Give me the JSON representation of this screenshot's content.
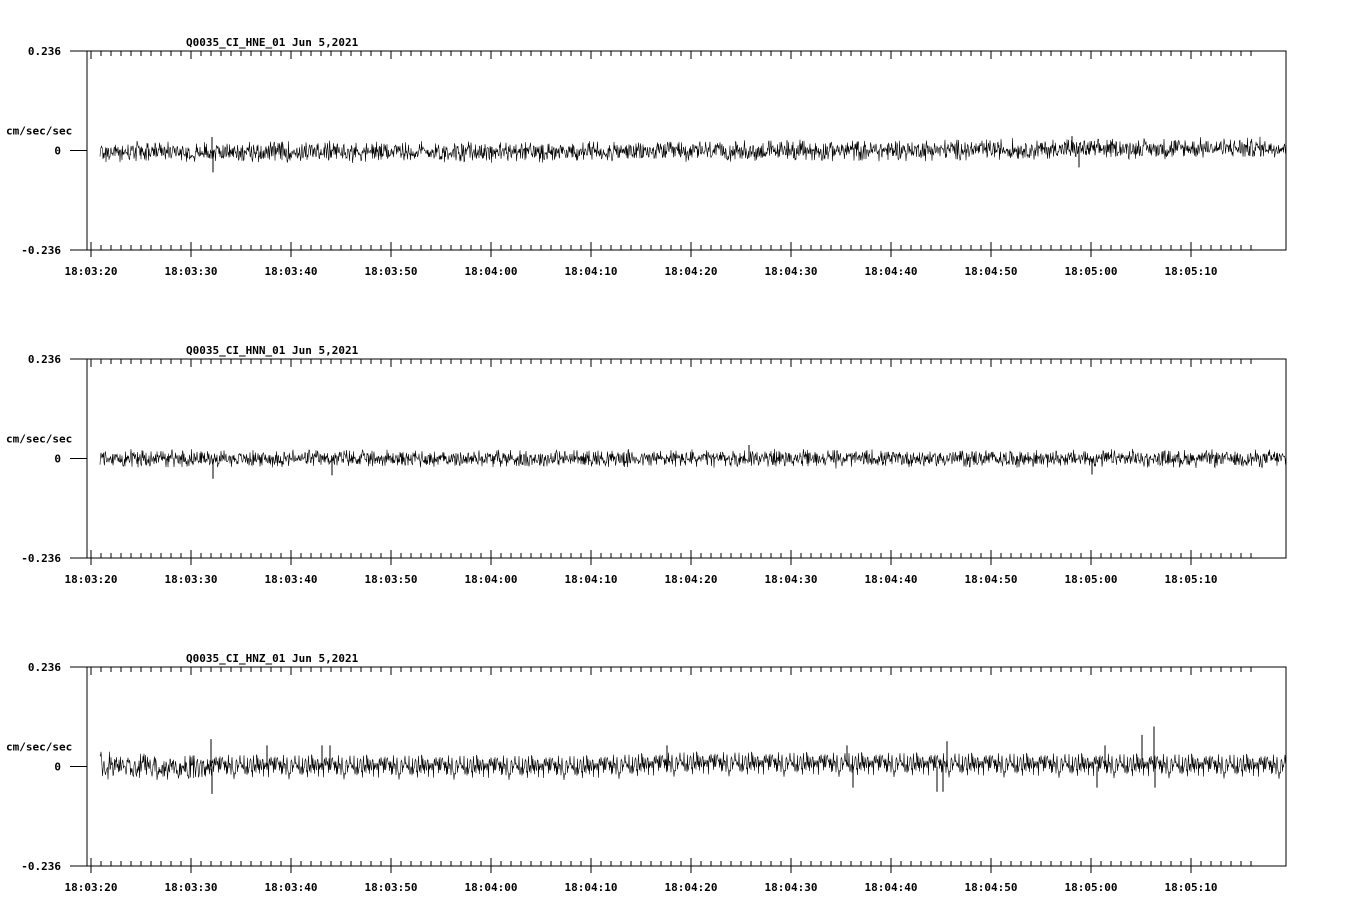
{
  "chart_data": [
    {
      "type": "line",
      "title": "Q0035_CI_HNE_01  Jun 5,2021",
      "ylabel": "cm/sec/sec",
      "ytick_labels": [
        "0.236",
        "0",
        "-0.236"
      ],
      "ylim": [
        -0.236,
        0.236
      ],
      "xtick_labels": [
        "18:03:20",
        "18:03:30",
        "18:03:40",
        "18:03:50",
        "18:04:00",
        "18:04:10",
        "18:04:20",
        "18:04:30",
        "18:04:40",
        "18:04:50",
        "18:05:00",
        "18:05:10"
      ],
      "x_start": "18:03:19.6",
      "x_end": "18:05:18.0",
      "noise_amplitude": 0.028,
      "trend": [
        [
          0,
          -0.004
        ],
        [
          60,
          -0.002
        ],
        [
          118,
          0.006
        ]
      ],
      "spikes": [
        [
          12.5,
          0.032
        ],
        [
          12.6,
          -0.052
        ],
        [
          70,
          0.024
        ],
        [
          98.5,
          0.034
        ],
        [
          99.2,
          -0.04
        ]
      ]
    },
    {
      "type": "line",
      "title": "Q0035_CI_HNN_01  Jun 5,2021",
      "ylabel": "cm/sec/sec",
      "ytick_labels": [
        "0.236",
        "0",
        "-0.236"
      ],
      "ylim": [
        -0.236,
        0.236
      ],
      "xtick_labels": [
        "18:03:20",
        "18:03:30",
        "18:03:40",
        "18:03:50",
        "18:04:00",
        "18:04:10",
        "18:04:20",
        "18:04:30",
        "18:04:40",
        "18:04:50",
        "18:05:00",
        "18:05:10"
      ],
      "x_start": "18:03:19.6",
      "x_end": "18:05:18.0",
      "noise_amplitude": 0.024,
      "trend": [
        [
          0,
          0.0
        ],
        [
          118,
          0.0
        ]
      ],
      "spikes": [
        [
          12.6,
          -0.048
        ],
        [
          24.5,
          -0.04
        ],
        [
          66.2,
          0.032
        ],
        [
          100.5,
          -0.038
        ]
      ]
    },
    {
      "type": "line",
      "title": "Q0035_CI_HNZ_01  Jun 5,2021",
      "ylabel": "cm/sec/sec",
      "ytick_labels": [
        "0.236",
        "0",
        "-0.236"
      ],
      "ylim": [
        -0.236,
        0.236
      ],
      "xtick_labels": [
        "18:03:20",
        "18:03:30",
        "18:03:40",
        "18:03:50",
        "18:04:00",
        "18:04:10",
        "18:04:20",
        "18:04:30",
        "18:04:40",
        "18:04:50",
        "18:05:00",
        "18:05:10"
      ],
      "x_start": "18:03:19.6",
      "x_end": "18:05:18.0",
      "noise_amplitude": 0.036,
      "trend": [
        [
          0,
          0.0
        ],
        [
          50,
          -0.003
        ],
        [
          60,
          0.006
        ],
        [
          118,
          0.0
        ]
      ],
      "spikes": [
        [
          12.4,
          0.065
        ],
        [
          12.5,
          -0.065
        ],
        [
          18,
          0.05
        ],
        [
          23.5,
          0.05
        ],
        [
          24.3,
          0.05
        ],
        [
          58,
          0.05
        ],
        [
          76,
          0.05
        ],
        [
          76.6,
          -0.05
        ],
        [
          85,
          -0.06
        ],
        [
          85.6,
          -0.06
        ],
        [
          86,
          0.06
        ],
        [
          101,
          -0.05
        ],
        [
          101.8,
          0.05
        ],
        [
          105.5,
          0.075
        ],
        [
          106.7,
          0.095
        ],
        [
          106.8,
          -0.05
        ]
      ]
    }
  ]
}
